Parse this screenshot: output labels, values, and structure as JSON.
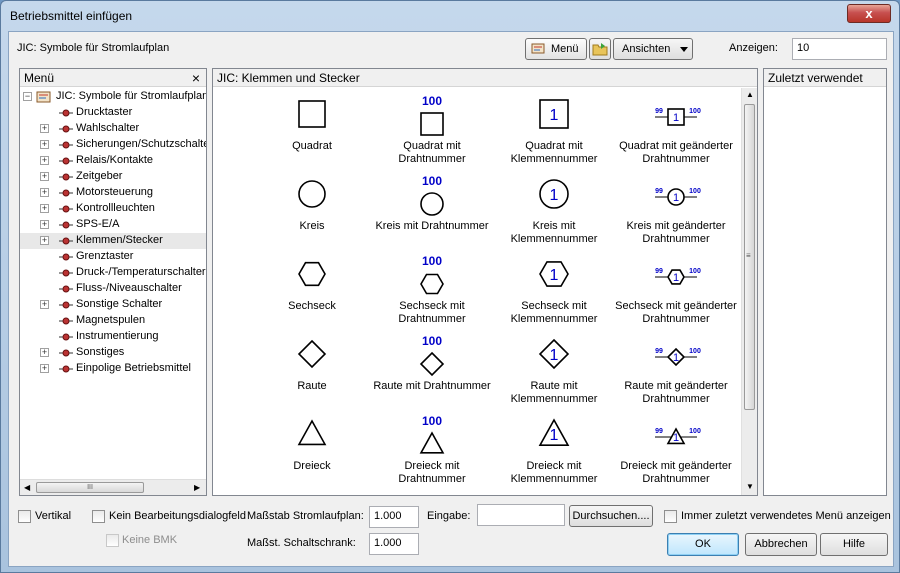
{
  "window": {
    "title": "Betriebsmittel einfügen",
    "close": "x"
  },
  "toolbar": {
    "library": "JIC: Symbole für Stromlaufplan",
    "menu_button": "Menü",
    "views_button": "Ansichten",
    "show_label": "Anzeigen:",
    "show_value": "10"
  },
  "menu_panel": {
    "title": "Menü",
    "close": "×",
    "root": "JIC: Symbole für Stromlaufplan",
    "items": [
      {
        "label": "Drucktaster",
        "exp": ""
      },
      {
        "label": "Wahlschalter",
        "exp": "+"
      },
      {
        "label": "Sicherungen/Schutzschalter",
        "exp": "+"
      },
      {
        "label": "Relais/Kontakte",
        "exp": "+"
      },
      {
        "label": "Zeitgeber",
        "exp": "+"
      },
      {
        "label": "Motorsteuerung",
        "exp": "+"
      },
      {
        "label": "Kontrollleuchten",
        "exp": "+"
      },
      {
        "label": "SPS-E/A",
        "exp": "+"
      },
      {
        "label": "Klemmen/Stecker",
        "exp": "+"
      },
      {
        "label": "Grenztaster",
        "exp": ""
      },
      {
        "label": "Druck-/Temperaturschalter",
        "exp": ""
      },
      {
        "label": "Fluss-/Niveauschalter",
        "exp": ""
      },
      {
        "label": "Sonstige Schalter",
        "exp": "+"
      },
      {
        "label": "Magnetspulen",
        "exp": ""
      },
      {
        "label": "Instrumentierung",
        "exp": ""
      },
      {
        "label": "Sonstiges",
        "exp": "+"
      },
      {
        "label": "Einpolige Betriebsmittel",
        "exp": "+"
      }
    ],
    "hscroll_grip": "III"
  },
  "symbols_panel": {
    "title": "JIC: Klemmen und Stecker",
    "wire_number": "100",
    "terminal_number": "1",
    "changed_left": "99",
    "changed_right": "100",
    "rows": [
      {
        "shape": "square",
        "captions": [
          "Quadrat",
          "Quadrat mit\nDrahtnummer",
          "Quadrat mit\nKlemmennummer",
          "Quadrat mit geänderter\nDrahtnummer"
        ]
      },
      {
        "shape": "circle",
        "captions": [
          "Kreis",
          "Kreis mit Drahtnummer",
          "Kreis mit\nKlemmennummer",
          "Kreis mit geänderter\nDrahtnummer"
        ]
      },
      {
        "shape": "hexagon",
        "captions": [
          "Sechseck",
          "Sechseck mit\nDrahtnummer",
          "Sechseck mit\nKlemmennummer",
          "Sechseck mit geänderter\nDrahtnummer"
        ]
      },
      {
        "shape": "diamond",
        "captions": [
          "Raute",
          "Raute mit Drahtnummer",
          "Raute mit\nKlemmennummer",
          "Raute mit geänderter\nDrahtnummer"
        ]
      },
      {
        "shape": "triangle",
        "captions": [
          "Dreieck",
          "Dreieck mit\nDrahtnummer",
          "Dreieck mit\nKlemmennummer",
          "Dreieck mit geänderter\nDrahtnummer"
        ]
      }
    ]
  },
  "recent_panel": {
    "title": "Zuletzt verwendet"
  },
  "bottom": {
    "vertical": "Vertikal",
    "no_edit_dialog": "Kein Bearbeitungsdialogfeld",
    "no_bmk": "Keine BMK",
    "scale_schematic_label": "Maßstab Stromlaufplan:",
    "scale_schematic_value": "1.000",
    "scale_cabinet_label": "Maßst. Schaltschrank:",
    "scale_cabinet_value": "1.000",
    "input_label": "Eingabe:",
    "input_value": "",
    "browse": "Durchsuchen....",
    "always_recent": "Immer zuletzt verwendetes Menü anzeigen",
    "ok": "OK",
    "cancel": "Abbrechen",
    "help": "Hilfe"
  },
  "colors": {
    "symbol_number": "#0000c8",
    "selection": "#e8e8e8"
  }
}
